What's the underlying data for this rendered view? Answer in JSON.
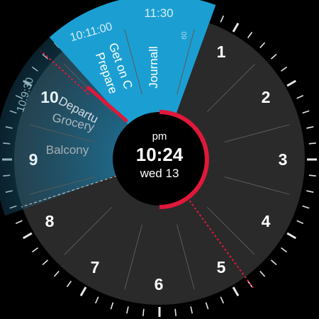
{
  "clock": {
    "period": "pm",
    "time": "10:24",
    "date": "wed 13"
  },
  "hour_numerals": [
    "1",
    "2",
    "3",
    "4",
    "5",
    "6",
    "7",
    "8",
    "9",
    "10"
  ],
  "events": [
    {
      "title": "Journall",
      "time_label": "11:30",
      "color": "#1b9fd2"
    },
    {
      "title": "Get on C",
      "subtitle": "Prepare",
      "time_label": "10:11:00",
      "color": "#1b9fd2"
    },
    {
      "title": "Departu",
      "subtitle": "Grocery",
      "time_label": "10:9:30",
      "color": "#1b6f94"
    },
    {
      "title": "Balcony",
      "color": "#1b6f94"
    }
  ],
  "small_labels": [
    "09",
    "9"
  ],
  "colors": {
    "face": "#2a2a2a",
    "accent": "#e0183a",
    "blue": "#1b9fd2",
    "dim_blue": "#1c6c90",
    "text": "#ffffff",
    "muted": "#9aa3a8"
  }
}
